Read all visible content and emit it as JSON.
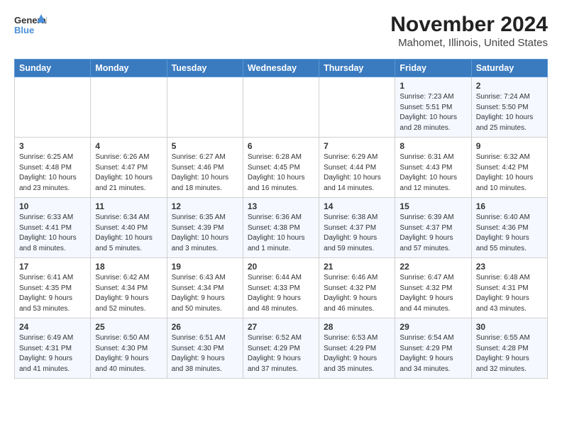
{
  "logo": {
    "line1": "General",
    "line2": "Blue"
  },
  "title": "November 2024",
  "subtitle": "Mahomet, Illinois, United States",
  "days_of_week": [
    "Sunday",
    "Monday",
    "Tuesday",
    "Wednesday",
    "Thursday",
    "Friday",
    "Saturday"
  ],
  "weeks": [
    [
      {
        "day": "",
        "info": ""
      },
      {
        "day": "",
        "info": ""
      },
      {
        "day": "",
        "info": ""
      },
      {
        "day": "",
        "info": ""
      },
      {
        "day": "",
        "info": ""
      },
      {
        "day": "1",
        "info": "Sunrise: 7:23 AM\nSunset: 5:51 PM\nDaylight: 10 hours and 28 minutes."
      },
      {
        "day": "2",
        "info": "Sunrise: 7:24 AM\nSunset: 5:50 PM\nDaylight: 10 hours and 25 minutes."
      }
    ],
    [
      {
        "day": "3",
        "info": "Sunrise: 6:25 AM\nSunset: 4:48 PM\nDaylight: 10 hours and 23 minutes."
      },
      {
        "day": "4",
        "info": "Sunrise: 6:26 AM\nSunset: 4:47 PM\nDaylight: 10 hours and 21 minutes."
      },
      {
        "day": "5",
        "info": "Sunrise: 6:27 AM\nSunset: 4:46 PM\nDaylight: 10 hours and 18 minutes."
      },
      {
        "day": "6",
        "info": "Sunrise: 6:28 AM\nSunset: 4:45 PM\nDaylight: 10 hours and 16 minutes."
      },
      {
        "day": "7",
        "info": "Sunrise: 6:29 AM\nSunset: 4:44 PM\nDaylight: 10 hours and 14 minutes."
      },
      {
        "day": "8",
        "info": "Sunrise: 6:31 AM\nSunset: 4:43 PM\nDaylight: 10 hours and 12 minutes."
      },
      {
        "day": "9",
        "info": "Sunrise: 6:32 AM\nSunset: 4:42 PM\nDaylight: 10 hours and 10 minutes."
      }
    ],
    [
      {
        "day": "10",
        "info": "Sunrise: 6:33 AM\nSunset: 4:41 PM\nDaylight: 10 hours and 8 minutes."
      },
      {
        "day": "11",
        "info": "Sunrise: 6:34 AM\nSunset: 4:40 PM\nDaylight: 10 hours and 5 minutes."
      },
      {
        "day": "12",
        "info": "Sunrise: 6:35 AM\nSunset: 4:39 PM\nDaylight: 10 hours and 3 minutes."
      },
      {
        "day": "13",
        "info": "Sunrise: 6:36 AM\nSunset: 4:38 PM\nDaylight: 10 hours and 1 minute."
      },
      {
        "day": "14",
        "info": "Sunrise: 6:38 AM\nSunset: 4:37 PM\nDaylight: 9 hours and 59 minutes."
      },
      {
        "day": "15",
        "info": "Sunrise: 6:39 AM\nSunset: 4:37 PM\nDaylight: 9 hours and 57 minutes."
      },
      {
        "day": "16",
        "info": "Sunrise: 6:40 AM\nSunset: 4:36 PM\nDaylight: 9 hours and 55 minutes."
      }
    ],
    [
      {
        "day": "17",
        "info": "Sunrise: 6:41 AM\nSunset: 4:35 PM\nDaylight: 9 hours and 53 minutes."
      },
      {
        "day": "18",
        "info": "Sunrise: 6:42 AM\nSunset: 4:34 PM\nDaylight: 9 hours and 52 minutes."
      },
      {
        "day": "19",
        "info": "Sunrise: 6:43 AM\nSunset: 4:34 PM\nDaylight: 9 hours and 50 minutes."
      },
      {
        "day": "20",
        "info": "Sunrise: 6:44 AM\nSunset: 4:33 PM\nDaylight: 9 hours and 48 minutes."
      },
      {
        "day": "21",
        "info": "Sunrise: 6:46 AM\nSunset: 4:32 PM\nDaylight: 9 hours and 46 minutes."
      },
      {
        "day": "22",
        "info": "Sunrise: 6:47 AM\nSunset: 4:32 PM\nDaylight: 9 hours and 44 minutes."
      },
      {
        "day": "23",
        "info": "Sunrise: 6:48 AM\nSunset: 4:31 PM\nDaylight: 9 hours and 43 minutes."
      }
    ],
    [
      {
        "day": "24",
        "info": "Sunrise: 6:49 AM\nSunset: 4:31 PM\nDaylight: 9 hours and 41 minutes."
      },
      {
        "day": "25",
        "info": "Sunrise: 6:50 AM\nSunset: 4:30 PM\nDaylight: 9 hours and 40 minutes."
      },
      {
        "day": "26",
        "info": "Sunrise: 6:51 AM\nSunset: 4:30 PM\nDaylight: 9 hours and 38 minutes."
      },
      {
        "day": "27",
        "info": "Sunrise: 6:52 AM\nSunset: 4:29 PM\nDaylight: 9 hours and 37 minutes."
      },
      {
        "day": "28",
        "info": "Sunrise: 6:53 AM\nSunset: 4:29 PM\nDaylight: 9 hours and 35 minutes."
      },
      {
        "day": "29",
        "info": "Sunrise: 6:54 AM\nSunset: 4:29 PM\nDaylight: 9 hours and 34 minutes."
      },
      {
        "day": "30",
        "info": "Sunrise: 6:55 AM\nSunset: 4:28 PM\nDaylight: 9 hours and 32 minutes."
      }
    ]
  ]
}
